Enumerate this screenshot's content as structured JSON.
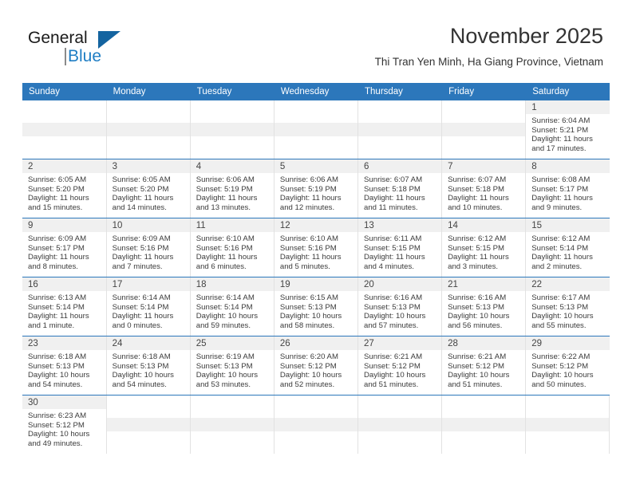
{
  "brand": {
    "name_part1": "General",
    "name_part2": "Blue",
    "triangle_color": "#1464a0",
    "blue_color": "#1f7ec4"
  },
  "header": {
    "title": "November 2025",
    "subtitle": "Thi Tran Yen Minh, Ha Giang Province, Vietnam"
  },
  "theme": {
    "header_band": "#2c77bb",
    "day_number_band": "#f0f0f0",
    "text": "#333333"
  },
  "weekdays": [
    "Sunday",
    "Monday",
    "Tuesday",
    "Wednesday",
    "Thursday",
    "Friday",
    "Saturday"
  ],
  "labels": {
    "sunrise": "Sunrise:",
    "sunset": "Sunset:",
    "daylight": "Daylight:"
  },
  "days": [
    {
      "n": "1",
      "col": 6,
      "sunrise": "Sunrise: 6:04 AM",
      "sunset": "Sunset: 5:21 PM",
      "daylight1": "Daylight: 11 hours",
      "daylight2": "and 17 minutes."
    },
    {
      "n": "2",
      "col": 0,
      "sunrise": "Sunrise: 6:05 AM",
      "sunset": "Sunset: 5:20 PM",
      "daylight1": "Daylight: 11 hours",
      "daylight2": "and 15 minutes."
    },
    {
      "n": "3",
      "col": 1,
      "sunrise": "Sunrise: 6:05 AM",
      "sunset": "Sunset: 5:20 PM",
      "daylight1": "Daylight: 11 hours",
      "daylight2": "and 14 minutes."
    },
    {
      "n": "4",
      "col": 2,
      "sunrise": "Sunrise: 6:06 AM",
      "sunset": "Sunset: 5:19 PM",
      "daylight1": "Daylight: 11 hours",
      "daylight2": "and 13 minutes."
    },
    {
      "n": "5",
      "col": 3,
      "sunrise": "Sunrise: 6:06 AM",
      "sunset": "Sunset: 5:19 PM",
      "daylight1": "Daylight: 11 hours",
      "daylight2": "and 12 minutes."
    },
    {
      "n": "6",
      "col": 4,
      "sunrise": "Sunrise: 6:07 AM",
      "sunset": "Sunset: 5:18 PM",
      "daylight1": "Daylight: 11 hours",
      "daylight2": "and 11 minutes."
    },
    {
      "n": "7",
      "col": 5,
      "sunrise": "Sunrise: 6:07 AM",
      "sunset": "Sunset: 5:18 PM",
      "daylight1": "Daylight: 11 hours",
      "daylight2": "and 10 minutes."
    },
    {
      "n": "8",
      "col": 6,
      "sunrise": "Sunrise: 6:08 AM",
      "sunset": "Sunset: 5:17 PM",
      "daylight1": "Daylight: 11 hours",
      "daylight2": "and 9 minutes."
    },
    {
      "n": "9",
      "col": 0,
      "sunrise": "Sunrise: 6:09 AM",
      "sunset": "Sunset: 5:17 PM",
      "daylight1": "Daylight: 11 hours",
      "daylight2": "and 8 minutes."
    },
    {
      "n": "10",
      "col": 1,
      "sunrise": "Sunrise: 6:09 AM",
      "sunset": "Sunset: 5:16 PM",
      "daylight1": "Daylight: 11 hours",
      "daylight2": "and 7 minutes."
    },
    {
      "n": "11",
      "col": 2,
      "sunrise": "Sunrise: 6:10 AM",
      "sunset": "Sunset: 5:16 PM",
      "daylight1": "Daylight: 11 hours",
      "daylight2": "and 6 minutes."
    },
    {
      "n": "12",
      "col": 3,
      "sunrise": "Sunrise: 6:10 AM",
      "sunset": "Sunset: 5:16 PM",
      "daylight1": "Daylight: 11 hours",
      "daylight2": "and 5 minutes."
    },
    {
      "n": "13",
      "col": 4,
      "sunrise": "Sunrise: 6:11 AM",
      "sunset": "Sunset: 5:15 PM",
      "daylight1": "Daylight: 11 hours",
      "daylight2": "and 4 minutes."
    },
    {
      "n": "14",
      "col": 5,
      "sunrise": "Sunrise: 6:12 AM",
      "sunset": "Sunset: 5:15 PM",
      "daylight1": "Daylight: 11 hours",
      "daylight2": "and 3 minutes."
    },
    {
      "n": "15",
      "col": 6,
      "sunrise": "Sunrise: 6:12 AM",
      "sunset": "Sunset: 5:14 PM",
      "daylight1": "Daylight: 11 hours",
      "daylight2": "and 2 minutes."
    },
    {
      "n": "16",
      "col": 0,
      "sunrise": "Sunrise: 6:13 AM",
      "sunset": "Sunset: 5:14 PM",
      "daylight1": "Daylight: 11 hours",
      "daylight2": "and 1 minute."
    },
    {
      "n": "17",
      "col": 1,
      "sunrise": "Sunrise: 6:14 AM",
      "sunset": "Sunset: 5:14 PM",
      "daylight1": "Daylight: 11 hours",
      "daylight2": "and 0 minutes."
    },
    {
      "n": "18",
      "col": 2,
      "sunrise": "Sunrise: 6:14 AM",
      "sunset": "Sunset: 5:14 PM",
      "daylight1": "Daylight: 10 hours",
      "daylight2": "and 59 minutes."
    },
    {
      "n": "19",
      "col": 3,
      "sunrise": "Sunrise: 6:15 AM",
      "sunset": "Sunset: 5:13 PM",
      "daylight1": "Daylight: 10 hours",
      "daylight2": "and 58 minutes."
    },
    {
      "n": "20",
      "col": 4,
      "sunrise": "Sunrise: 6:16 AM",
      "sunset": "Sunset: 5:13 PM",
      "daylight1": "Daylight: 10 hours",
      "daylight2": "and 57 minutes."
    },
    {
      "n": "21",
      "col": 5,
      "sunrise": "Sunrise: 6:16 AM",
      "sunset": "Sunset: 5:13 PM",
      "daylight1": "Daylight: 10 hours",
      "daylight2": "and 56 minutes."
    },
    {
      "n": "22",
      "col": 6,
      "sunrise": "Sunrise: 6:17 AM",
      "sunset": "Sunset: 5:13 PM",
      "daylight1": "Daylight: 10 hours",
      "daylight2": "and 55 minutes."
    },
    {
      "n": "23",
      "col": 0,
      "sunrise": "Sunrise: 6:18 AM",
      "sunset": "Sunset: 5:13 PM",
      "daylight1": "Daylight: 10 hours",
      "daylight2": "and 54 minutes."
    },
    {
      "n": "24",
      "col": 1,
      "sunrise": "Sunrise: 6:18 AM",
      "sunset": "Sunset: 5:13 PM",
      "daylight1": "Daylight: 10 hours",
      "daylight2": "and 54 minutes."
    },
    {
      "n": "25",
      "col": 2,
      "sunrise": "Sunrise: 6:19 AM",
      "sunset": "Sunset: 5:13 PM",
      "daylight1": "Daylight: 10 hours",
      "daylight2": "and 53 minutes."
    },
    {
      "n": "26",
      "col": 3,
      "sunrise": "Sunrise: 6:20 AM",
      "sunset": "Sunset: 5:12 PM",
      "daylight1": "Daylight: 10 hours",
      "daylight2": "and 52 minutes."
    },
    {
      "n": "27",
      "col": 4,
      "sunrise": "Sunrise: 6:21 AM",
      "sunset": "Sunset: 5:12 PM",
      "daylight1": "Daylight: 10 hours",
      "daylight2": "and 51 minutes."
    },
    {
      "n": "28",
      "col": 5,
      "sunrise": "Sunrise: 6:21 AM",
      "sunset": "Sunset: 5:12 PM",
      "daylight1": "Daylight: 10 hours",
      "daylight2": "and 51 minutes."
    },
    {
      "n": "29",
      "col": 6,
      "sunrise": "Sunrise: 6:22 AM",
      "sunset": "Sunset: 5:12 PM",
      "daylight1": "Daylight: 10 hours",
      "daylight2": "and 50 minutes."
    },
    {
      "n": "30",
      "col": 0,
      "sunrise": "Sunrise: 6:23 AM",
      "sunset": "Sunset: 5:12 PM",
      "daylight1": "Daylight: 10 hours",
      "daylight2": "and 49 minutes."
    }
  ]
}
